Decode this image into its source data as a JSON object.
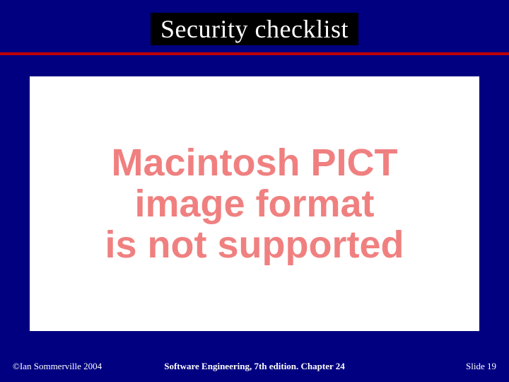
{
  "title": "Security checklist",
  "content": {
    "line1": "Macintosh PICT",
    "line2": "image format",
    "line3": "is not supported"
  },
  "footer": {
    "left": "©Ian Sommerville 2004",
    "center": "Software Engineering, 7th edition. Chapter 24",
    "right_label": "Slide",
    "right_number": "19"
  },
  "colors": {
    "background": "#000080",
    "title_bg": "#000000",
    "rule": "#c00000",
    "content_bg": "#ffffff",
    "content_text": "#f08080",
    "footer_text": "#ffffff"
  }
}
